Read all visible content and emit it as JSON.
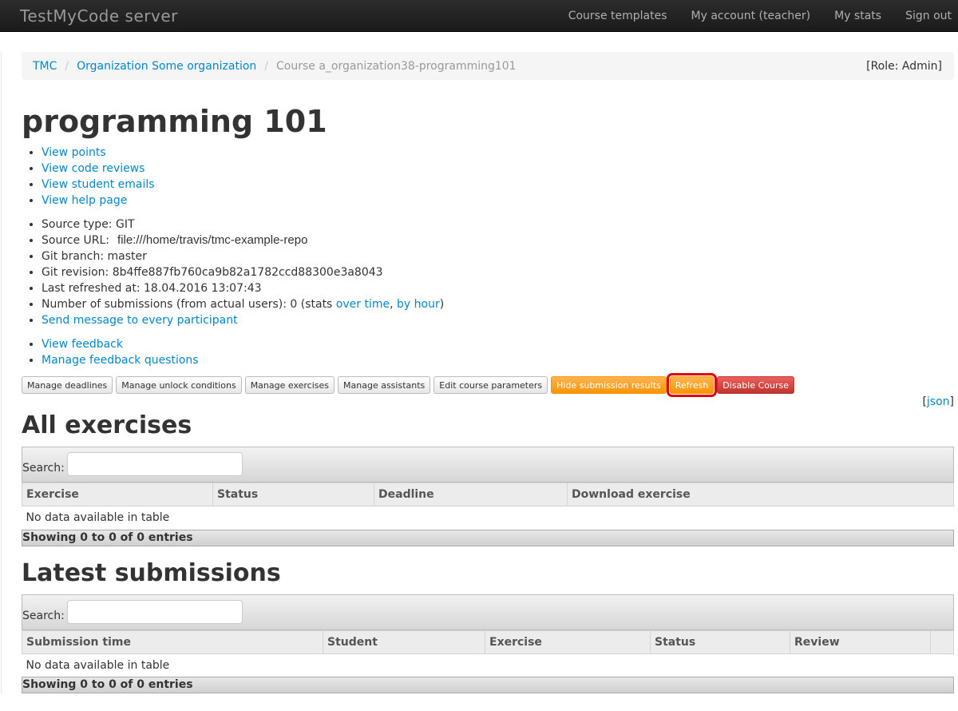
{
  "nav": {
    "brand": "TestMyCode server",
    "links": [
      "Course templates",
      "My account (teacher)",
      "My stats",
      "Sign out"
    ]
  },
  "breadcrumb": {
    "items": [
      "TMC",
      "Organization Some organization"
    ],
    "active": "Course a_organization38-programming101",
    "role": "[Role: Admin]"
  },
  "page": {
    "title": "programming 101",
    "links1": [
      "View points",
      "View code reviews",
      "View student emails",
      "View help page"
    ],
    "info": {
      "source_type": "Source type: GIT",
      "source_url_label": "Source URL:",
      "source_url": "file:///home/travis/tmc-example-repo",
      "git_branch": "Git branch: master",
      "git_revision": "Git revision: 8b4ffe887fb760ca9b82a1782ccd88300e3a8043",
      "last_refreshed": "Last refreshed at: 18.04.2016 13:07:43",
      "submissions_prefix": "Number of submissions (from actual users): 0 (stats ",
      "over_time": "over time",
      "comma": ", ",
      "by_hour": "by hour",
      "submissions_suffix": ")",
      "send_message": "Send message to every participant"
    },
    "links2": [
      "View feedback",
      "Manage feedback questions"
    ]
  },
  "buttons": {
    "manage_deadlines": "Manage deadlines",
    "manage_unlock": "Manage unlock conditions",
    "manage_exercises": "Manage exercises",
    "manage_assistants": "Manage assistants",
    "edit_params": "Edit course parameters",
    "hide_results": "Hide submission results",
    "refresh": "Refresh",
    "disable": "Disable Course"
  },
  "json_link": {
    "open": "[",
    "label": "json",
    "close": "]"
  },
  "exercises": {
    "heading": "All exercises",
    "search_label": "Search:",
    "columns": [
      "Exercise",
      "Status",
      "Deadline",
      "Download exercise"
    ],
    "empty": "No data available in table",
    "info": "Showing 0 to 0 of 0 entries"
  },
  "submissions": {
    "heading": "Latest submissions",
    "search_label": "Search:",
    "columns": [
      "Submission time",
      "Student",
      "Exercise",
      "Status",
      "Review",
      ""
    ],
    "empty": "No data available in table",
    "info": "Showing 0 to 0 of 0 entries"
  },
  "colors": {
    "link": "#0088cc",
    "warning": "#f89406",
    "danger": "#bd362f",
    "highlight": "#e00000"
  }
}
